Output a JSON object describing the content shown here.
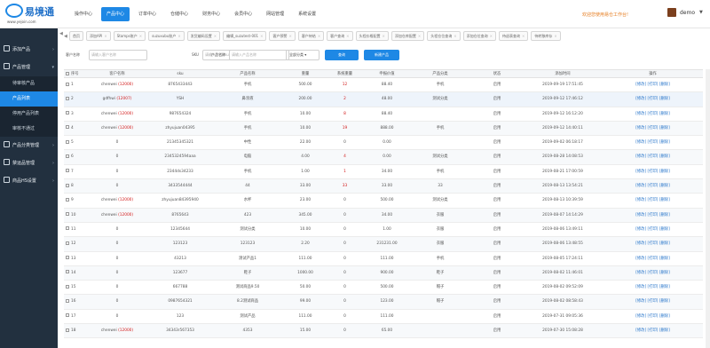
{
  "header": {
    "logo_text": "易境通",
    "logo_url": "www.yejoin.com",
    "nav": [
      "操作中心",
      "产品中心",
      "订单中心",
      "仓储中心",
      "财务中心",
      "会员中心",
      "网站管理",
      "系统设置"
    ],
    "active_nav": "产品中心",
    "welcome": "欢迎您使用易仓工作台!",
    "user": "demo",
    "brand_color": "#1e88e5"
  },
  "sidebar": {
    "groups": [
      {
        "label": "添加产品",
        "sub": []
      },
      {
        "label": "产品管理",
        "sub": [
          "待审核产品",
          "产品列表",
          "停用产品列表",
          "审核不通过"
        ]
      },
      {
        "label": "产品分类管理",
        "sub": []
      },
      {
        "label": "禁运品管理",
        "sub": []
      },
      {
        "label": "商品HS设置",
        "sub": []
      }
    ],
    "active_sub": "产品列表"
  },
  "tabs": [
    "首页",
    "添加API",
    "Stamps账户",
    "suzuxubu账户",
    "发货编码设置",
    "编辑_suzutest-001",
    "客户预警",
    "客户待结",
    "客户查询",
    "头程价格配置",
    "添加仓库配置",
    "头程仓位查询",
    "添加仓位查询",
    "待退表查询",
    "待转移库存"
  ],
  "filter": {
    "customer_label": "客户名称",
    "customer_placeholder": "请输入客户名称",
    "sku_label": "SKU",
    "sku_placeholder": "请输入产品sku",
    "product_label": "产品名称",
    "product_placeholder": "请输入产品名称",
    "category_select": "全部分类",
    "search_btn": "查询",
    "new_btn": "新建产品"
  },
  "table": {
    "columns": [
      "序号",
      "客户名称",
      "sku",
      "产品名称",
      "重量",
      "系统重量",
      "申报价值",
      "产品分类",
      "状态",
      "添加时间",
      "操作"
    ],
    "actions": "[修改] [打印] [删除]",
    "rows": [
      {
        "no": "1",
        "cust": "chenwei",
        "code": "(12000)",
        "sku": "8765433443",
        "name": "手机",
        "weight": "500.00",
        "sysw": "12",
        "decl": "88.40",
        "cat": "手机",
        "status": "启用",
        "time": "2019-09-19 17:51:45"
      },
      {
        "no": "2",
        "cust": "gdfhwi",
        "code": "(12007)",
        "sku": "YSH",
        "name": "鼻涂液",
        "weight": "200.00",
        "sysw": "2",
        "decl": "48.00",
        "cat": "测试分类",
        "status": "启用",
        "time": "2019-09-12 17:46:12"
      },
      {
        "no": "3",
        "cust": "chenwei",
        "code": "(12000)",
        "sku": "987654324",
        "name": "手机",
        "weight": "10.00",
        "sysw": "8",
        "decl": "88.40",
        "cat": "",
        "status": "启用",
        "time": "2019-09-12 16:12:20"
      },
      {
        "no": "4",
        "cust": "chenwei",
        "code": "(12000)",
        "sku": "zhyujuan04395",
        "name": "手机",
        "weight": "10.00",
        "sysw": "19",
        "decl": "888.00",
        "cat": "手机",
        "status": "启用",
        "time": "2019-09-12 14:40:11"
      },
      {
        "no": "5",
        "cust": "0",
        "code": "",
        "sku": "21345345321",
        "name": "中性",
        "weight": "22.00",
        "sysw": "0",
        "decl": "0.00",
        "cat": "",
        "status": "启用",
        "time": "2019-09-02 06:18:17"
      },
      {
        "no": "6",
        "cust": "0",
        "code": "",
        "sku": "2345324594aaa",
        "name": "电脑",
        "weight": "4.00",
        "sysw": "4",
        "decl": "0.00",
        "cat": "测试分类",
        "status": "启用",
        "time": "2019-08-28 14:08:53"
      },
      {
        "no": "7",
        "cust": "0",
        "code": "",
        "sku": "2344ds34233",
        "name": "手机",
        "weight": "1.00",
        "sysw": "1",
        "decl": "34.00",
        "cat": "手机",
        "status": "启用",
        "time": "2019-08-21 17:00:59"
      },
      {
        "no": "8",
        "cust": "0",
        "code": "",
        "sku": "3433544444",
        "name": "44",
        "weight": "33.00",
        "sysw": "33",
        "decl": "33.00",
        "cat": "33",
        "status": "启用",
        "time": "2019-08-13 13:54:21"
      },
      {
        "no": "9",
        "cust": "chenwei",
        "code": "(12000)",
        "sku": "zhyujuan84395940",
        "name": "水杯",
        "weight": "23.00",
        "sysw": "0",
        "decl": "500.00",
        "cat": "测试分类",
        "status": "启用",
        "time": "2019-08-13 10:39:59"
      },
      {
        "no": "10",
        "cust": "chenwei",
        "code": "(12000)",
        "sku": "8765643",
        "name": "423",
        "weight": "345.00",
        "sysw": "0",
        "decl": "34.00",
        "cat": "衣服",
        "status": "启用",
        "time": "2019-08-07 14:14:29"
      },
      {
        "no": "11",
        "cust": "0",
        "code": "",
        "sku": "12345644",
        "name": "测试分类",
        "weight": "10.00",
        "sysw": "0",
        "decl": "1.00",
        "cat": "衣服",
        "status": "启用",
        "time": "2019-08-06 13:49:11"
      },
      {
        "no": "12",
        "cust": "0",
        "code": "",
        "sku": "123123",
        "name": "123123",
        "weight": "2.20",
        "sysw": "0",
        "decl": "231231.00",
        "cat": "衣服",
        "status": "启用",
        "time": "2019-08-06 13:48:55"
      },
      {
        "no": "13",
        "cust": "0",
        "code": "",
        "sku": "43213",
        "name": "测试产品1",
        "weight": "111.00",
        "sysw": "0",
        "decl": "111.00",
        "cat": "手机",
        "status": "启用",
        "time": "2019-08-05 17:24:11"
      },
      {
        "no": "14",
        "cust": "0",
        "code": "",
        "sku": "123677",
        "name": "鞋子",
        "weight": "1000.00",
        "sysw": "0",
        "decl": "900.00",
        "cat": "鞋子",
        "status": "启用",
        "time": "2019-08-02 11:46:01"
      },
      {
        "no": "15",
        "cust": "0",
        "code": "",
        "sku": "667788",
        "name": "测试商品9.50",
        "weight": "50.00",
        "sysw": "0",
        "decl": "500.00",
        "cat": "帽子",
        "status": "启用",
        "time": "2019-08-02 09:52:09"
      },
      {
        "no": "16",
        "cust": "0",
        "code": "",
        "sku": "0987654321",
        "name": "8.2测试商品",
        "weight": "99.00",
        "sysw": "0",
        "decl": "123.00",
        "cat": "帽子",
        "status": "启用",
        "time": "2019-08-02 08:58:43"
      },
      {
        "no": "17",
        "cust": "0",
        "code": "",
        "sku": "123",
        "name": "测试产品",
        "weight": "111.00",
        "sysw": "0",
        "decl": "111.00",
        "cat": "",
        "status": "启用",
        "time": "2019-07-31 09:05:36"
      },
      {
        "no": "18",
        "cust": "chenwei",
        "code": "(12000)",
        "sku": "34343r567353",
        "name": "4353",
        "weight": "15.00",
        "sysw": "0",
        "decl": "65.00",
        "cat": "",
        "status": "启用",
        "time": "2019-07-30 15:08:28"
      }
    ]
  }
}
